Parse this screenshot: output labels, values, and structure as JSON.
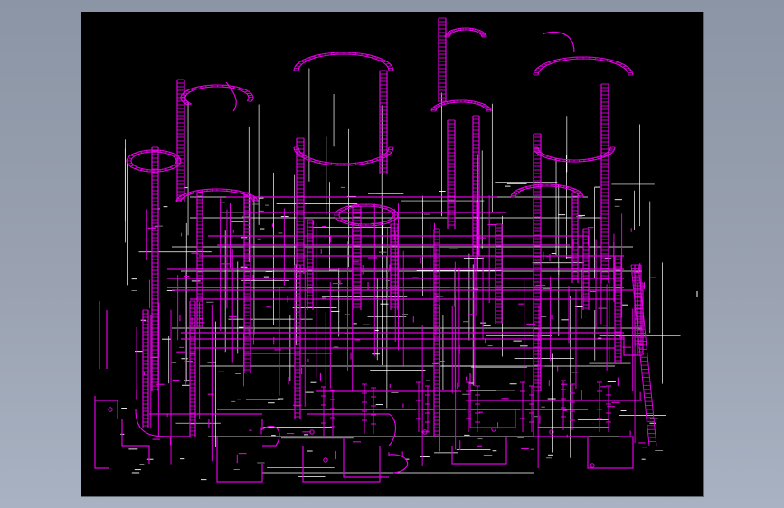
{
  "viewport": {
    "background_color": "#9aa2b1"
  },
  "drawing": {
    "paper_color": "#000000",
    "line_colors": {
      "primary": "#e100e1",
      "secondary": "#ffffff",
      "dim": "#8a8a8a"
    },
    "content": "piping-isometric"
  }
}
